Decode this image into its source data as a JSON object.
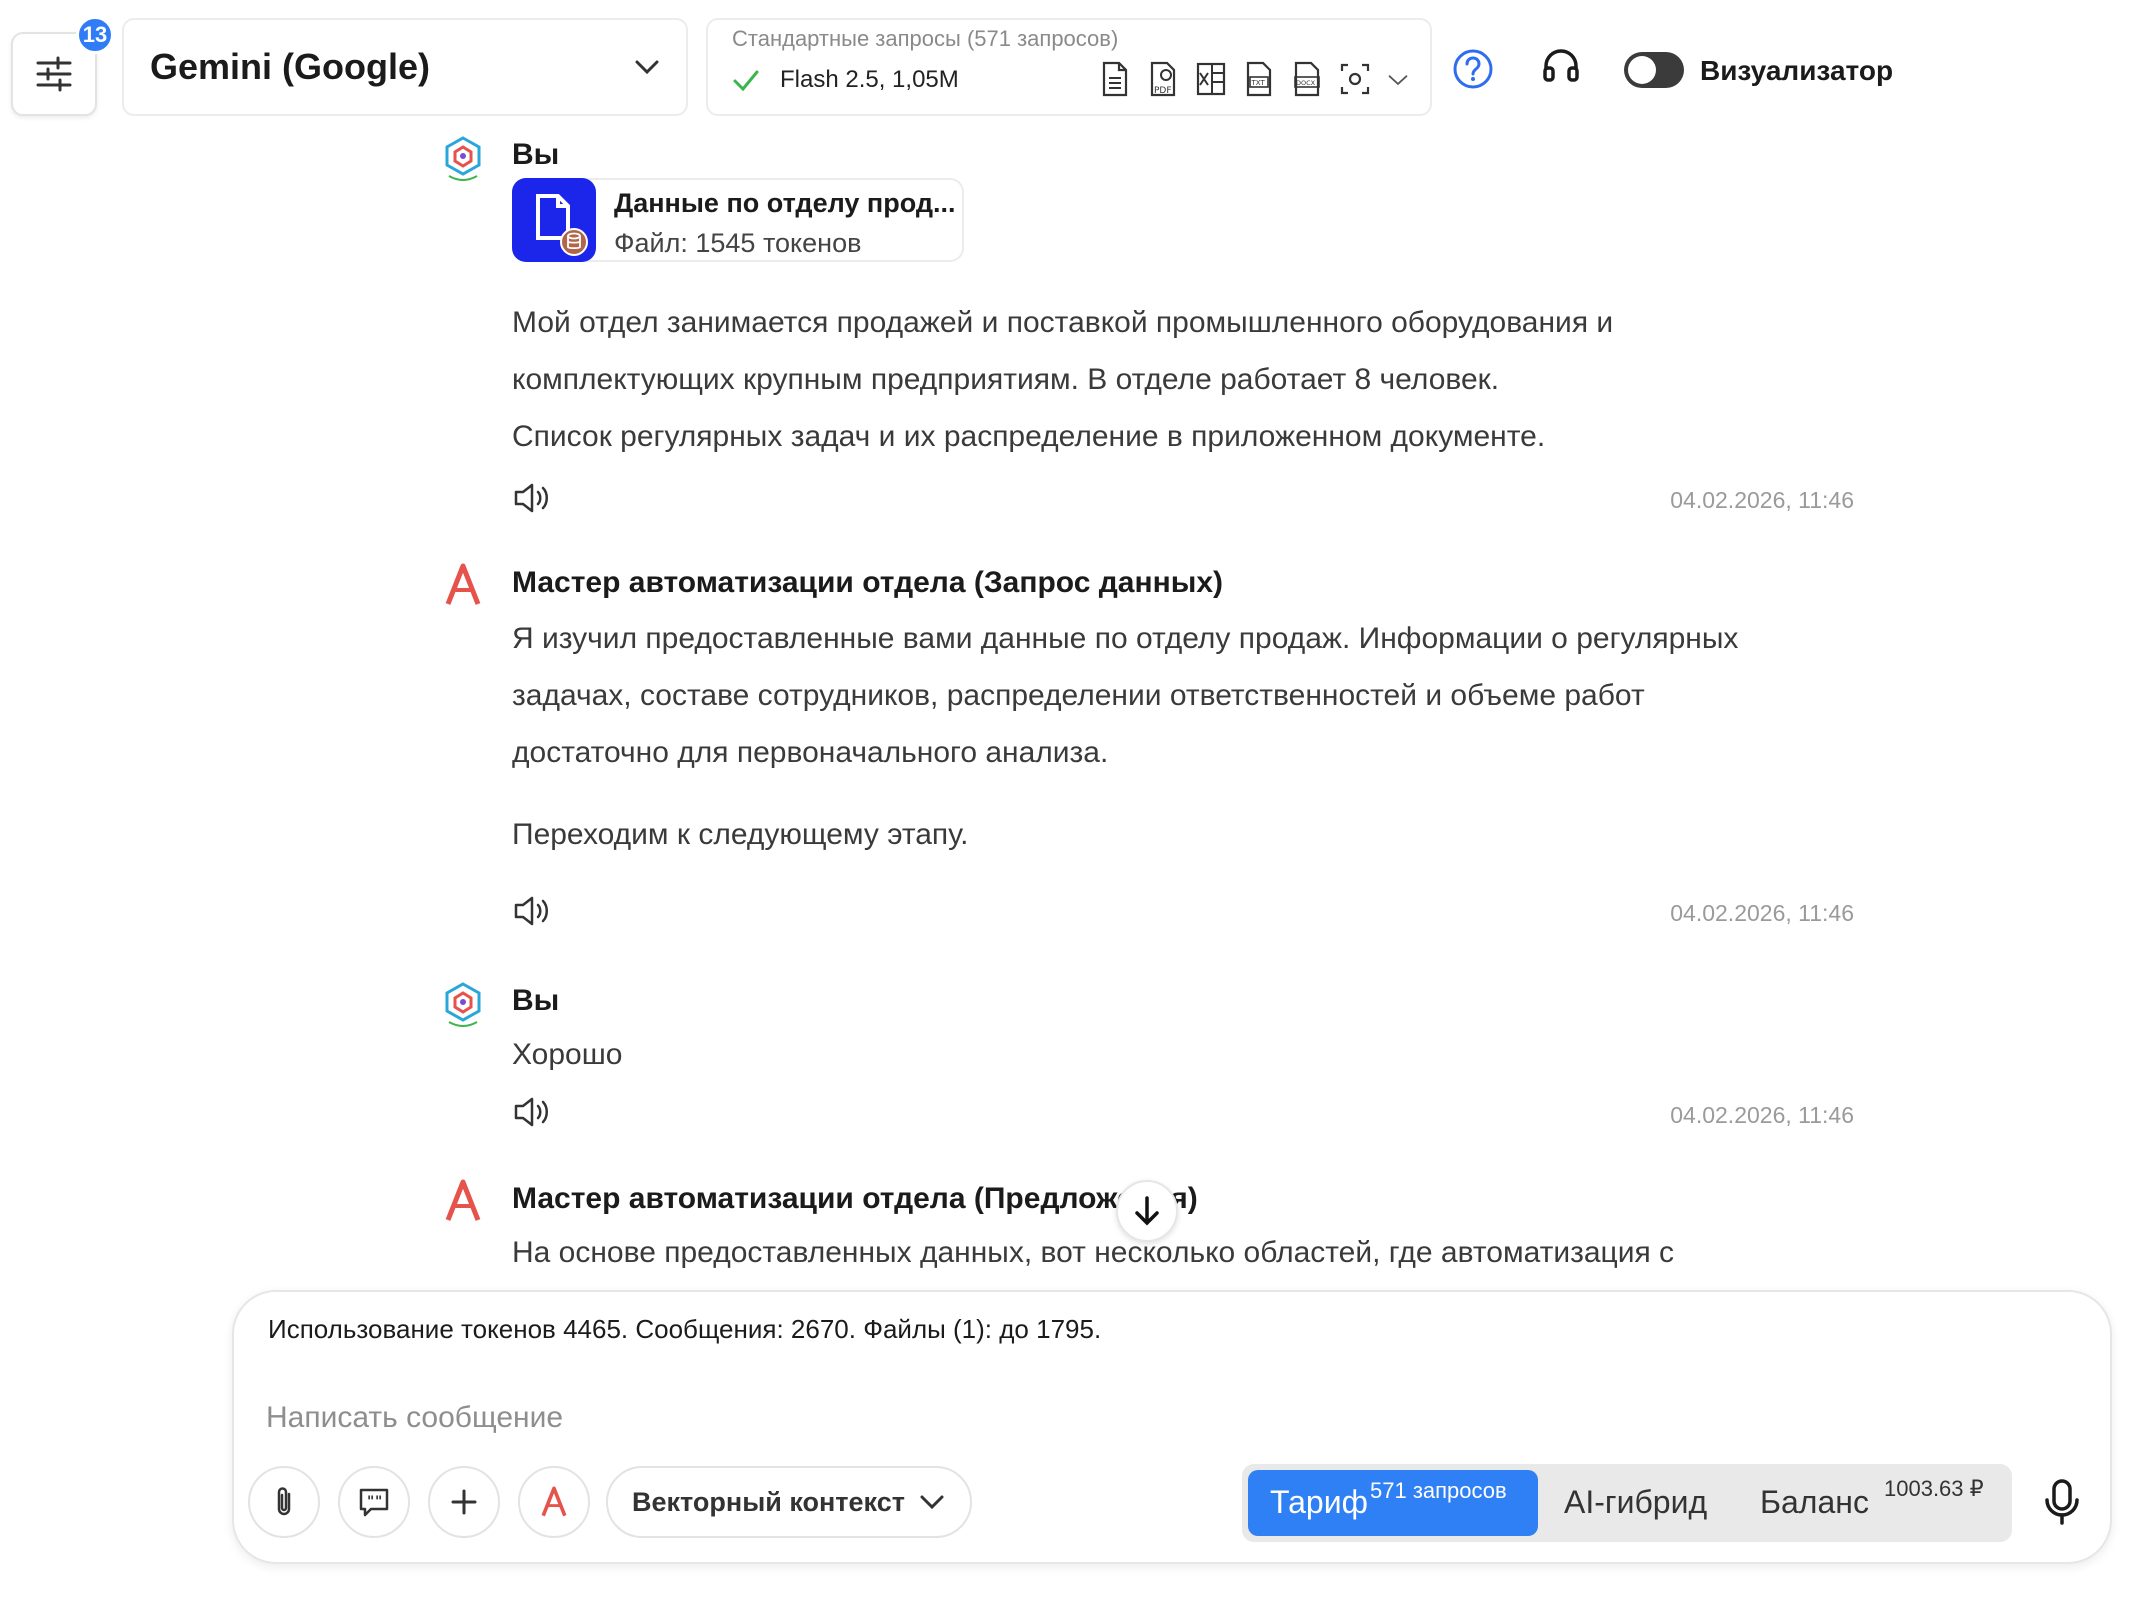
{
  "header": {
    "settings_badge": "13",
    "model_name": "Gemini (Google)",
    "requests_title": "Стандартные запросы (571 запросов)",
    "flash_label": "Flash 2.5, 1,05M",
    "visualizer_label": "Визуализатор"
  },
  "messages": [
    {
      "author": "Вы",
      "file": {
        "name": "Данные по отделу прод...",
        "sub": "Файл: 1545 токенов"
      },
      "lines": [
        "Мой отдел занимается продажей и поставкой промышленного оборудования и",
        "комплектующих крупным предприятиям. В отделе работает 8 человек.",
        "Список регулярных задач и их распределение в приложенном документе."
      ],
      "time": "04.02.2026, 11:46"
    },
    {
      "author": "Мастер автоматизации отдела (Запрос данных)",
      "lines": [
        "Я изучил предоставленные вами данные по отделу продаж. Информации о регулярных",
        "задачах, составе сотрудников, распределении ответственностей и объеме работ",
        "достаточно для первоначального анализа."
      ],
      "line2": "Переходим к следующему этапу.",
      "time": "04.02.2026, 11:46"
    },
    {
      "author": "Вы",
      "lines": [
        "Хорошо"
      ],
      "time": "04.02.2026, 11:46"
    },
    {
      "author": "Мастер автоматизации отдела (Предложения)",
      "lines": [
        "На основе предоставленных данных, вот несколько областей, где автоматизация с"
      ]
    }
  ],
  "composer": {
    "usage": "Использование токенов 4465. Сообщения: 2670. Файлы (1): до 1795.",
    "placeholder": "Написать сообщение",
    "vector_label": "Векторный контекст",
    "tariff_label": "Тариф",
    "tariff_sup": "571 запросов",
    "hybrid_label": "AI-гибрид",
    "balance_label": "Баланс",
    "balance_sup": "1003.63 ₽"
  },
  "colors": {
    "accent": "#2f80f4",
    "file_icon": "#1c26ea",
    "check": "#3cb54a",
    "agent_logo": "#e5534b"
  }
}
